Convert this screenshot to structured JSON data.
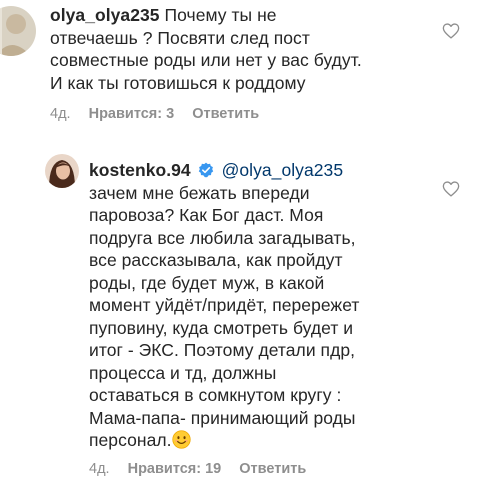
{
  "comments": [
    {
      "username": "olya_olya235",
      "lines": [
        "Почему ты не",
        "отвечаешь ? Посвяти след пост",
        "совместные роды или нет у вас будут.",
        "И как ты готовишься к роддому"
      ],
      "time": "4д.",
      "likes": "Нравится: 3",
      "reply": "Ответить",
      "avatar_icon": "user-avatar",
      "like_icon": "heart-outline-icon"
    },
    {
      "username": "kostenko.94",
      "verified_icon": "verified-badge-icon",
      "mention": "@olya_olya235",
      "lines": [
        "зачем мне бежать впереди",
        "паровоза? Как Бог даст. Моя",
        "подруга все любила загадывать,",
        "все рассказывала, как пройдут",
        "роды, где будет муж, в какой",
        "момент уйдёт/придёт, перережет",
        "пуповину, куда смотреть будет  и",
        "итог - ЭКС.  Поэтому детали пдр,",
        "процесса и тд, должны",
        "оставаться в сомкнутом кругу :",
        "Мама-папа- принимающий роды",
        "персонал."
      ],
      "emoji_icon": "smiling-face-emoji-icon",
      "time": "4д.",
      "likes": "Нравится: 19",
      "reply": "Ответить",
      "avatar_icon": "user-avatar",
      "like_icon": "heart-outline-icon"
    }
  ],
  "colors": {
    "text": "#262626",
    "meta": "#8e8e8e",
    "mention": "#00376b",
    "verified": "#3897f0"
  }
}
